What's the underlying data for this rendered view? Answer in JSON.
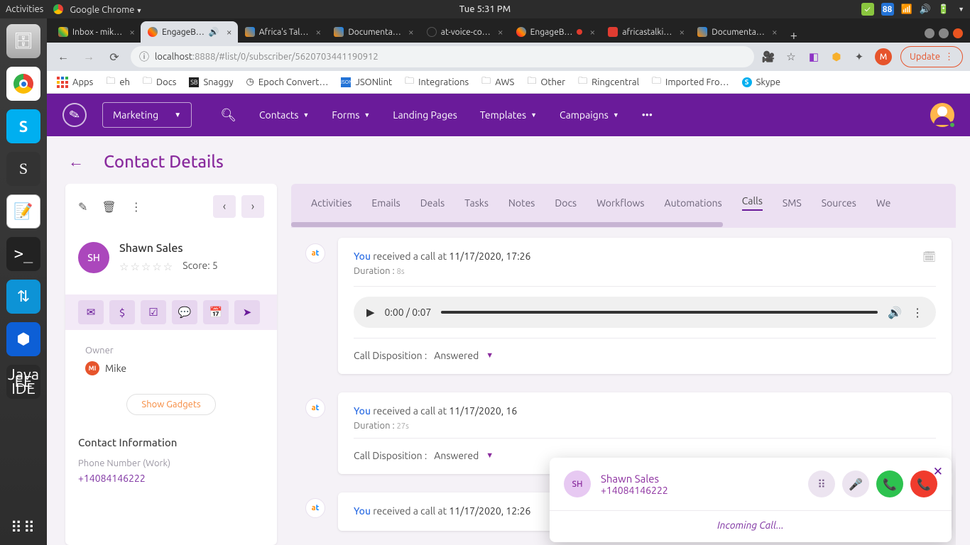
{
  "os": {
    "activities": "Activities",
    "app": "Google Chrome",
    "clock": "Tue  5:31 PM"
  },
  "tabs": [
    {
      "label": "Inbox - mik…"
    },
    {
      "label": "EngageB…"
    },
    {
      "label": "Africa's Tal…"
    },
    {
      "label": "Documenta…"
    },
    {
      "label": "at-voice-co…"
    },
    {
      "label": "EngageB…"
    },
    {
      "label": "africastalki…"
    },
    {
      "label": "Documenta…"
    }
  ],
  "url": {
    "host": "localhost",
    "port": ":8888",
    "path": "/#list/0/subscriber/5620703441190912"
  },
  "update": "Update",
  "bookmarks": [
    "Apps",
    "eh",
    "Docs",
    "Snaggy",
    "Epoch Convert…",
    "JSONlint",
    "Integrations",
    "AWS",
    "Other",
    "Ringcentral",
    "Imported Fro…",
    "Skype"
  ],
  "nav": {
    "select": "Marketing",
    "items": [
      "Contacts",
      "Forms",
      "Landing Pages",
      "Templates",
      "Campaigns"
    ]
  },
  "page": {
    "title": "Contact Details"
  },
  "contact": {
    "initials": "SH",
    "name": "Shawn Sales",
    "score_label": "Score: 5",
    "owner_label": "Owner",
    "owner_name": "Mike",
    "owner_initials": "MI",
    "show_gadgets": "Show Gadgets",
    "ci_head": "Contact Information",
    "phone_label": "Phone Number (Work)",
    "phone": "+14084146222"
  },
  "detail_tabs": [
    "Activities",
    "Emails",
    "Deals",
    "Tasks",
    "Notes",
    "Docs",
    "Workflows",
    "Automations",
    "Calls",
    "SMS",
    "Sources",
    "We"
  ],
  "calls": [
    {
      "you": "You",
      "text": " received a call at ",
      "datetime": "11/17/2020, 17:26",
      "dur_label": "Duration : ",
      "dur": "8s",
      "audio": {
        "current": "0:00",
        "total": "0:07"
      },
      "disp_label": "Call Disposition : ",
      "disp": "Answered"
    },
    {
      "you": "You",
      "text": " received a call at ",
      "datetime": "11/17/2020, 16",
      "dur_label": "Duration : ",
      "dur": "27s",
      "disp_label": "Call Disposition : ",
      "disp": "Answered"
    },
    {
      "you": "You",
      "text": " received a call at ",
      "datetime": "11/17/2020, 12:26"
    }
  ],
  "popup": {
    "initials": "SH",
    "name": "Shawn Sales",
    "phone": "+14084146222",
    "status": "Incoming Call..."
  }
}
